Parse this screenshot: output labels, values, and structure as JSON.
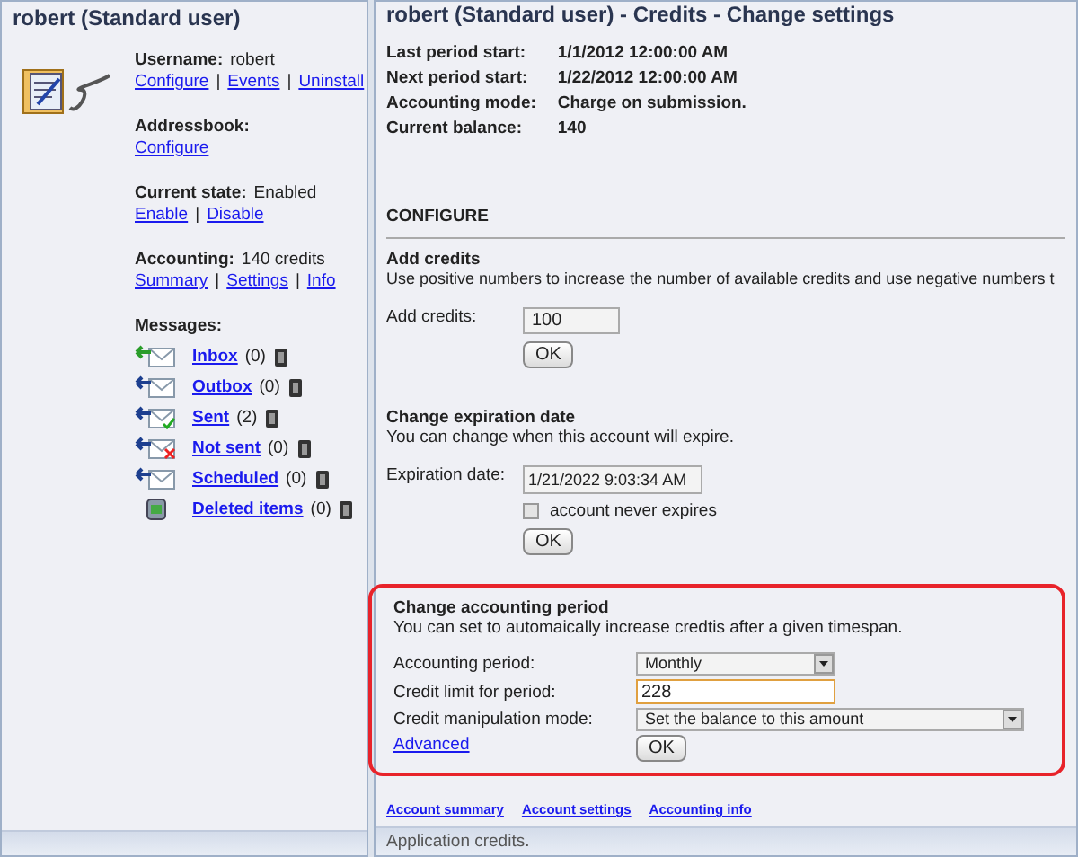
{
  "left_panel": {
    "title": "robert (Standard user)",
    "separator": "|",
    "groups": [
      {
        "label": "Username:",
        "value": "robert",
        "links": [
          "Configure",
          "Events",
          "Uninstall"
        ]
      },
      {
        "label": "Addressbook:",
        "links": [
          "Configure"
        ]
      },
      {
        "label": "Current state:",
        "value": "Enabled",
        "links": [
          "Enable",
          "Disable"
        ]
      },
      {
        "label": "Accounting:",
        "value": "140 credits",
        "links": [
          "Summary",
          "Settings",
          "Info"
        ]
      }
    ],
    "messages_label": "Messages:",
    "folders": [
      {
        "kind": "inbox",
        "name": "Inbox",
        "count": "(0)"
      },
      {
        "kind": "outbox",
        "name": "Outbox",
        "count": "(0)"
      },
      {
        "kind": "sent",
        "name": "Sent",
        "count": "(2)"
      },
      {
        "kind": "notsent",
        "name": "Not sent",
        "count": "(0)"
      },
      {
        "kind": "scheduled",
        "name": "Scheduled",
        "count": "(0)"
      },
      {
        "kind": "deleted",
        "name": "Deleted items",
        "count": "(0)"
      }
    ]
  },
  "main_panel": {
    "title": "robert (Standard user) - Credits - Change settings",
    "details": [
      {
        "label": "Last period start:",
        "value": "1/1/2012 12:00:00 AM"
      },
      {
        "label": "Next period start:",
        "value": "1/22/2012 12:00:00 AM"
      },
      {
        "label": "Accounting mode:",
        "value": "Charge on submission."
      },
      {
        "label": "Current balance:",
        "value": "140"
      }
    ],
    "configure_heading": "CONFIGURE",
    "add_credits": {
      "title": "Add credits",
      "description": "Use positive numbers to increase the number of available credits and use negative numbers t",
      "field_label": "Add credits:",
      "value": "100",
      "button": "OK"
    },
    "expiration": {
      "title": "Change expiration date",
      "description": "You can change when this account will expire.",
      "field_label": "Expiration date:",
      "value": "1/21/2022 9:03:34 AM",
      "checkbox_label": "account never expires",
      "checked": false,
      "button": "OK"
    },
    "accounting_period": {
      "title": "Change accounting period",
      "description": "You can set to automaically increase credtis after a given timespan.",
      "highlighted": true,
      "period_label": "Accounting period:",
      "period_value": "Monthly",
      "limit_label": "Credit limit for period:",
      "limit_value": "228",
      "mode_label": "Credit manipulation mode:",
      "mode_value": "Set the balance to this amount",
      "advanced_link": "Advanced",
      "button": "OK"
    },
    "footer_links": [
      "Account summary",
      "Account settings",
      "Accounting info"
    ],
    "status_bar": "Application credits."
  }
}
